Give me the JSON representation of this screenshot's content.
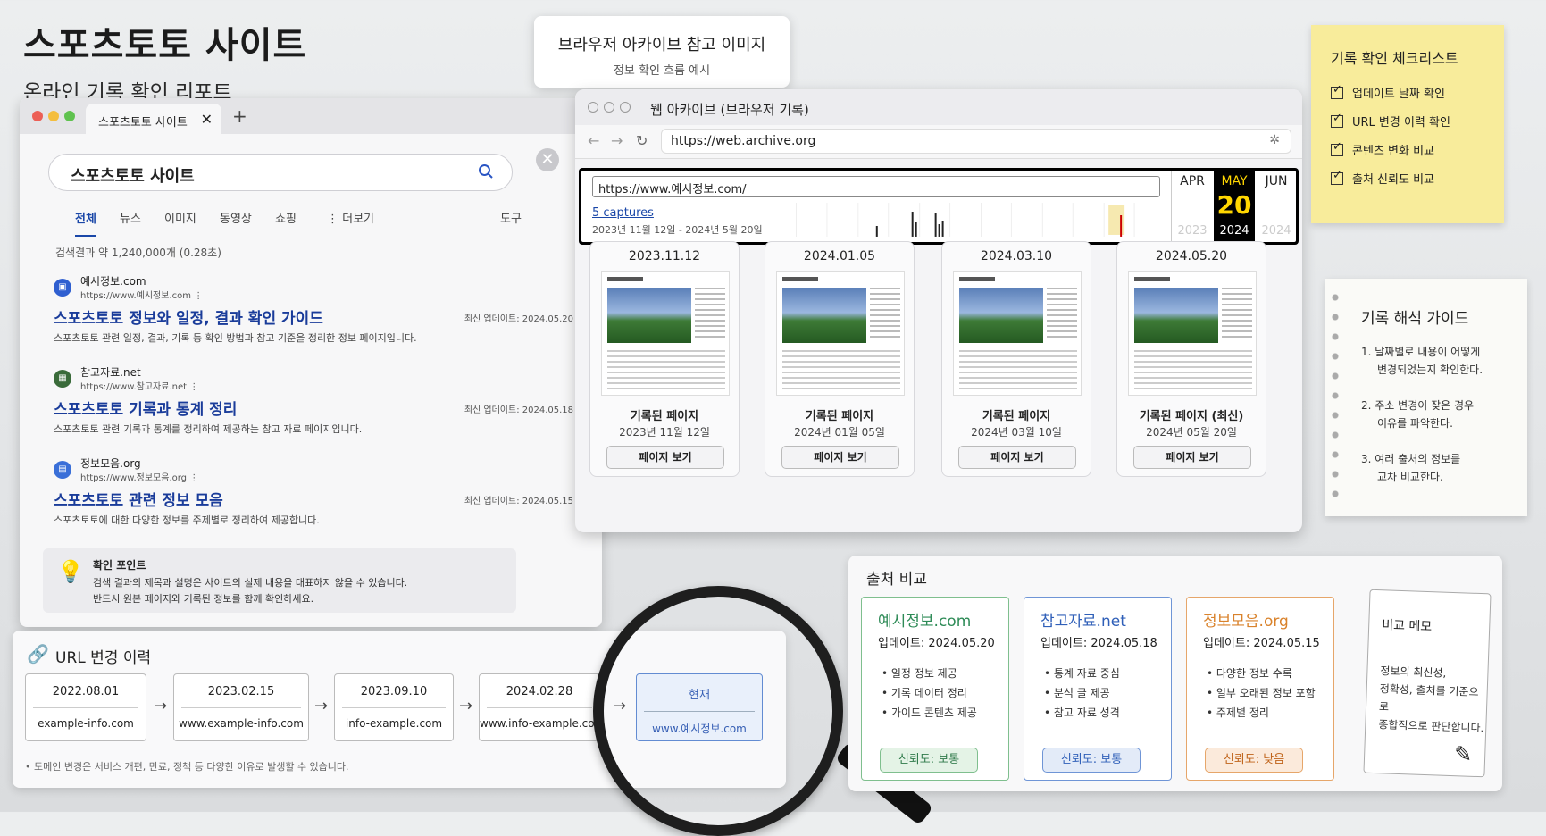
{
  "heading": {
    "title": "스포츠토토 사이트",
    "subtitle": "온라인 기록 확인 리포트"
  },
  "titlecard": {
    "title": "브라우저 아카이브 참고 이미지",
    "sub": "정보 확인 흐름 예시"
  },
  "search": {
    "tab_title": "스포츠토토 사이트",
    "query": "스포츠토토 사이트",
    "tabs": [
      "전체",
      "뉴스",
      "이미지",
      "동영상",
      "쇼핑",
      "⋮ 더보기",
      "도구"
    ],
    "result_count": "검색결과 약 1,240,000개 (0.28초)",
    "results": [
      {
        "site": "예시정보.com",
        "url": "https://www.예시정보.com ⋮",
        "title": "스포츠토토 정보와 일정, 결과 확인 가이드",
        "updated": "최신 업데이트: 2024.05.20",
        "desc": "스포츠토토 관련 일정, 결과, 기록 등 확인 방법과 참고 기준을 정리한 정보 페이지입니다.",
        "color": "#2f5fd0"
      },
      {
        "site": "참고자료.net",
        "url": "https://www.참고자료.net ⋮",
        "title": "스포츠토토 기록과 통계 정리",
        "updated": "최신 업데이트: 2024.05.18",
        "desc": "스포츠토토 관련 기록과 통계를 정리하여 제공하는 참고 자료 페이지입니다.",
        "color": "#3a6b3a"
      },
      {
        "site": "정보모음.org",
        "url": "https://www.정보모음.org ⋮",
        "title": "스포츠토토 관련 정보 모음",
        "updated": "최신 업데이트: 2024.05.15",
        "desc": "스포츠토토에 대한 다양한 정보를 주제별로 정리하여 제공합니다.",
        "color": "#3a6fd8"
      }
    ],
    "tip": {
      "title": "확인 포인트",
      "line1": "검색 결과의 제목과 설명은 사이트의 실제 내용을 대표하지 않을 수 있습니다.",
      "line2": "반드시 원본 페이지와 기록된 정보를 함께 확인하세요."
    }
  },
  "archive": {
    "window_title": "웹 아카이브 (브라우저 기록)",
    "address": "https://web.archive.org",
    "lookup_url": "https://www.예시정보.com/",
    "captures": "5 captures",
    "range": "2023년 11월 12일 - 2024년 5월 20일",
    "calendar": {
      "months": [
        "APR",
        "MAY",
        "JUN"
      ],
      "day": "20",
      "years": [
        "2023",
        "2024",
        "2024"
      ]
    },
    "snapshots": [
      {
        "date": "2023.11.12",
        "label": "기록된 페이지",
        "long_date": "2023년 11월 12일",
        "button": "페이지 보기"
      },
      {
        "date": "2024.01.05",
        "label": "기록된 페이지",
        "long_date": "2024년 01월 05일",
        "button": "페이지 보기"
      },
      {
        "date": "2024.03.10",
        "label": "기록된 페이지",
        "long_date": "2024년 03월 10일",
        "button": "페이지 보기"
      },
      {
        "date": "2024.05.20",
        "label": "기록된 페이지 (최신)",
        "long_date": "2024년 05월 20일",
        "button": "페이지 보기"
      }
    ]
  },
  "checklist": {
    "title": "기록 확인 체크리스트",
    "items": [
      "업데이트 날짜 확인",
      "URL 변경 이력 확인",
      "콘텐츠 변화 비교",
      "출처 신뢰도 비교"
    ]
  },
  "guide": {
    "title": "기록 해석 가이드",
    "items": [
      [
        "1. 날짜별로 내용이 어떻게",
        "변경되었는지 확인한다."
      ],
      [
        "2. 주소 변경이 잦은 경우",
        "이유를 파악한다."
      ],
      [
        "3. 여러 출처의 정보를",
        "교차 비교한다."
      ]
    ]
  },
  "url_history": {
    "title": "URL 변경 이력",
    "entries": [
      {
        "date": "2022.08.01",
        "url": "example-info.com"
      },
      {
        "date": "2023.02.15",
        "url": "www.example-info.com"
      },
      {
        "date": "2023.09.10",
        "url": "info-example.com"
      },
      {
        "date": "2024.02.28",
        "url": "www.info-example.com"
      },
      {
        "date": "현재",
        "url": "www.예시정보.com"
      }
    ],
    "footnote": "• 도메인 변경은 서비스 개편, 만료, 정책 등 다양한 이유로 발생할 수 있습니다."
  },
  "compare": {
    "title": "출처 비교",
    "sources": [
      {
        "name": "예시정보.com",
        "updated": "업데이트: 2024.05.20",
        "bullets": [
          "• 일정 정보 제공",
          "• 기록 데이터 정리",
          "• 가이드 콘텐츠 제공"
        ],
        "trust": "신뢰도: 보통",
        "color": "#2e8b57",
        "bg": "#e4f3e6"
      },
      {
        "name": "참고자료.net",
        "updated": "업데이트: 2024.05.18",
        "bullets": [
          "• 통계 자료 중심",
          "• 분석 글 제공",
          "• 참고 자료 성격"
        ],
        "trust": "신뢰도: 보통",
        "color": "#2f5fb8",
        "bg": "#e3ebf8"
      },
      {
        "name": "정보모음.org",
        "updated": "업데이트: 2024.05.15",
        "bullets": [
          "• 다양한 정보 수록",
          "• 일부 오래된 정보 포함",
          "• 주제별 정리"
        ],
        "trust": "신뢰도: 낮음",
        "color": "#d9822b",
        "bg": "#fbeadb"
      }
    ],
    "memo": {
      "title": "비교 메모",
      "lines": [
        "정보의 최신성,",
        "정확성, 출처를 기준으로",
        "종합적으로 판단합니다."
      ]
    }
  }
}
